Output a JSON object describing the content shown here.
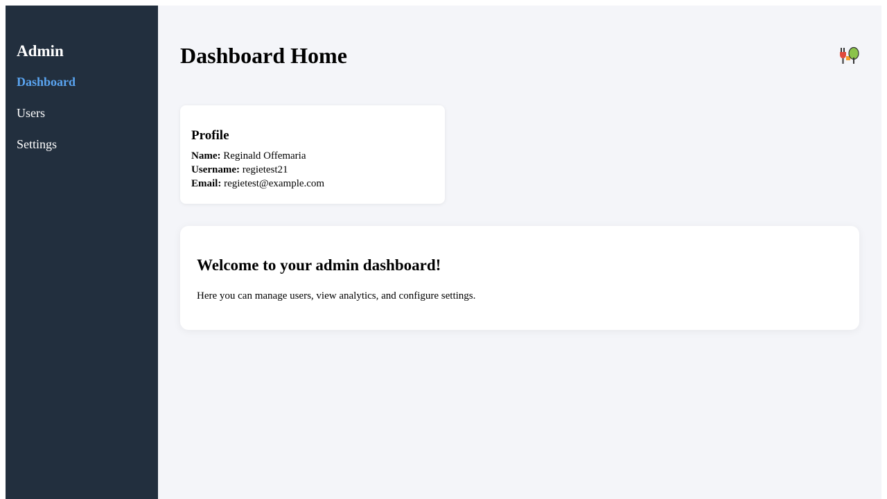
{
  "sidebar": {
    "title": "Admin",
    "items": [
      {
        "label": "Dashboard",
        "active": true
      },
      {
        "label": "Users",
        "active": false
      },
      {
        "label": "Settings",
        "active": false
      }
    ]
  },
  "header": {
    "title": "Dashboard Home",
    "icon": "food-and-tree-icon"
  },
  "profile": {
    "title": "Profile",
    "name_label": "Name:",
    "name_value": "Reginald Offemaria",
    "username_label": "Username:",
    "username_value": "regietest21",
    "email_label": "Email:",
    "email_value": "regietest@example.com"
  },
  "welcome": {
    "title": "Welcome to your admin dashboard!",
    "text": "Here you can manage users, view analytics, and configure settings."
  },
  "colors": {
    "sidebar_bg": "#222f3e",
    "active_nav": "#5aa4f0",
    "main_bg": "#f4f5f9"
  }
}
